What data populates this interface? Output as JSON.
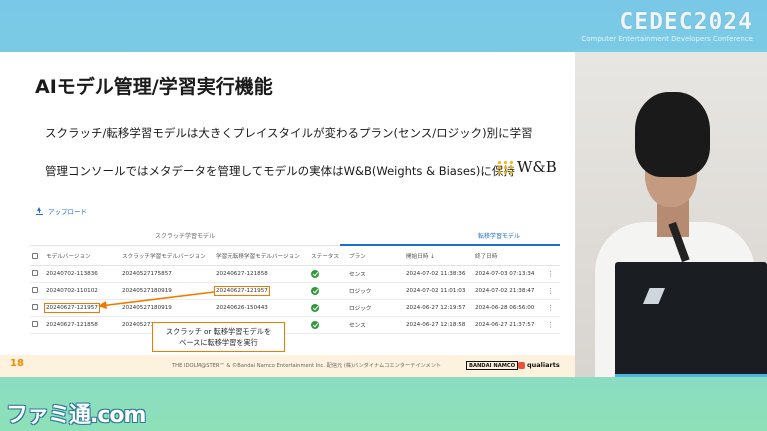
{
  "event_logo": {
    "title": "CEDEC2024",
    "subtitle": "Computer Entertainment Developers Conference"
  },
  "slide": {
    "title": "AIモデル管理/学習実行機能",
    "bullets": [
      "スクラッチ/転移学習モデルは大きくプレイスタイルが変わるプラン(センス/ロジック)別に学習",
      "管理コンソールではメタデータを管理してモデルの実体はW&B(Weights & Biases)に保持"
    ],
    "wb_logo_text": "W&B",
    "page_number": "18",
    "copyright": "THE IDOLM@STER™ & ©Bandai Namco Entertainment Inc.  配信元 (株)バンダイナムコエンターテインメント",
    "bandai_logo": "BANDAI NAMCO",
    "qualiarts_logo": "qualiarts"
  },
  "console": {
    "upload_label": "アップロード",
    "tabs": [
      "スクラッチ学習モデル",
      "転移学習モデル"
    ],
    "active_tab": 1,
    "columns": [
      "モデルバージョン",
      "スクラッチ学習モデルバージョン",
      "学習元転移学習モデルバージョン",
      "ステータス",
      "プラン",
      "開始日時 ↓",
      "終了日時"
    ],
    "rows": [
      {
        "model": "20240702-113836",
        "scratch": "20240527175857",
        "source": "20240627-121858",
        "plan": "センス",
        "start": "2024-07-02 11:38:36",
        "end": "2024-07-03 07:13:34"
      },
      {
        "model": "20240702-110102",
        "scratch": "20240527180919",
        "source": "20240627-121957",
        "plan": "ロジック",
        "start": "2024-07-02 11:01:03",
        "end": "2024-07-02 21:38:47"
      },
      {
        "model": "20240627-121957",
        "scratch": "20240527180919",
        "source": "20240626-150443",
        "plan": "ロジック",
        "start": "2024-06-27 12:19:57",
        "end": "2024-06-28 06:56:00"
      },
      {
        "model": "20240627-121858",
        "scratch": "2024052717",
        "source": "",
        "plan": "センス",
        "start": "2024-06-27 12:18:58",
        "end": "2024-06-27 21:37:57"
      }
    ],
    "status_icon": "check-circle-icon",
    "callout_lines": [
      "スクラッチ or 転移学習モデルを",
      "ベースに転移学習を実行"
    ]
  },
  "watermark": "ファミ通.com",
  "colors": {
    "accent_blue": "#1e6fd0",
    "highlight_orange": "#f07a00",
    "status_green": "#2e9a3c",
    "footer_bg": "#fdf2dd",
    "page_number": "#f08a00"
  }
}
